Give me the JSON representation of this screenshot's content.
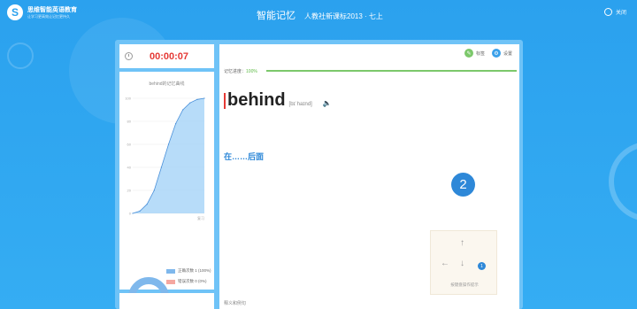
{
  "app": {
    "logo_mark": "S",
    "logo_text": "思维智能英语教育",
    "logo_subtext": "让学习更高效让记忆更持久",
    "title": "智能记忆",
    "subtitle": "人教社新课标2013 · 七上",
    "close_label": "关闭"
  },
  "sidebar": {
    "timer": "00:00:07",
    "chart_title": "behind的记忆曲线",
    "legend": [
      {
        "label": "正确次数 1 (100%)",
        "color": "#7fb8ec"
      },
      {
        "label": "错误次数 0 (0%)",
        "color": "#f5a7a0"
      }
    ]
  },
  "main": {
    "toolbar": {
      "tag_label": "标签",
      "settings_label": "设置"
    },
    "progress": {
      "label": "记忆进度：",
      "percent_text": "100%",
      "value": 1.0
    },
    "word": "behind",
    "phonetic": "[bɪˈhaɪnd]",
    "meaning": "在……后面",
    "count": "2",
    "key_hint": {
      "up": "↑",
      "left": "←",
      "down": "↓",
      "badge": "1",
      "label": "按键盘操作提示"
    },
    "footer_label": "释义和例句"
  },
  "chart_data": {
    "type": "area",
    "title": "behind的记忆曲线",
    "xlabel": "",
    "ylabel": "",
    "x": [
      0,
      1,
      2,
      3,
      4,
      5,
      6,
      7,
      8,
      9,
      10
    ],
    "y": [
      0,
      2,
      8,
      20,
      40,
      60,
      78,
      90,
      96,
      99,
      100
    ],
    "ylim": [
      0,
      100
    ],
    "y_ticks": [
      "0",
      "20",
      "40",
      "60",
      "80",
      "100"
    ],
    "x_tick_label": "复习",
    "grid": true,
    "colors": {
      "line": "#4a90d9",
      "fill": "#9fd0f7"
    },
    "donut": {
      "correct": 1,
      "wrong": 0
    }
  }
}
